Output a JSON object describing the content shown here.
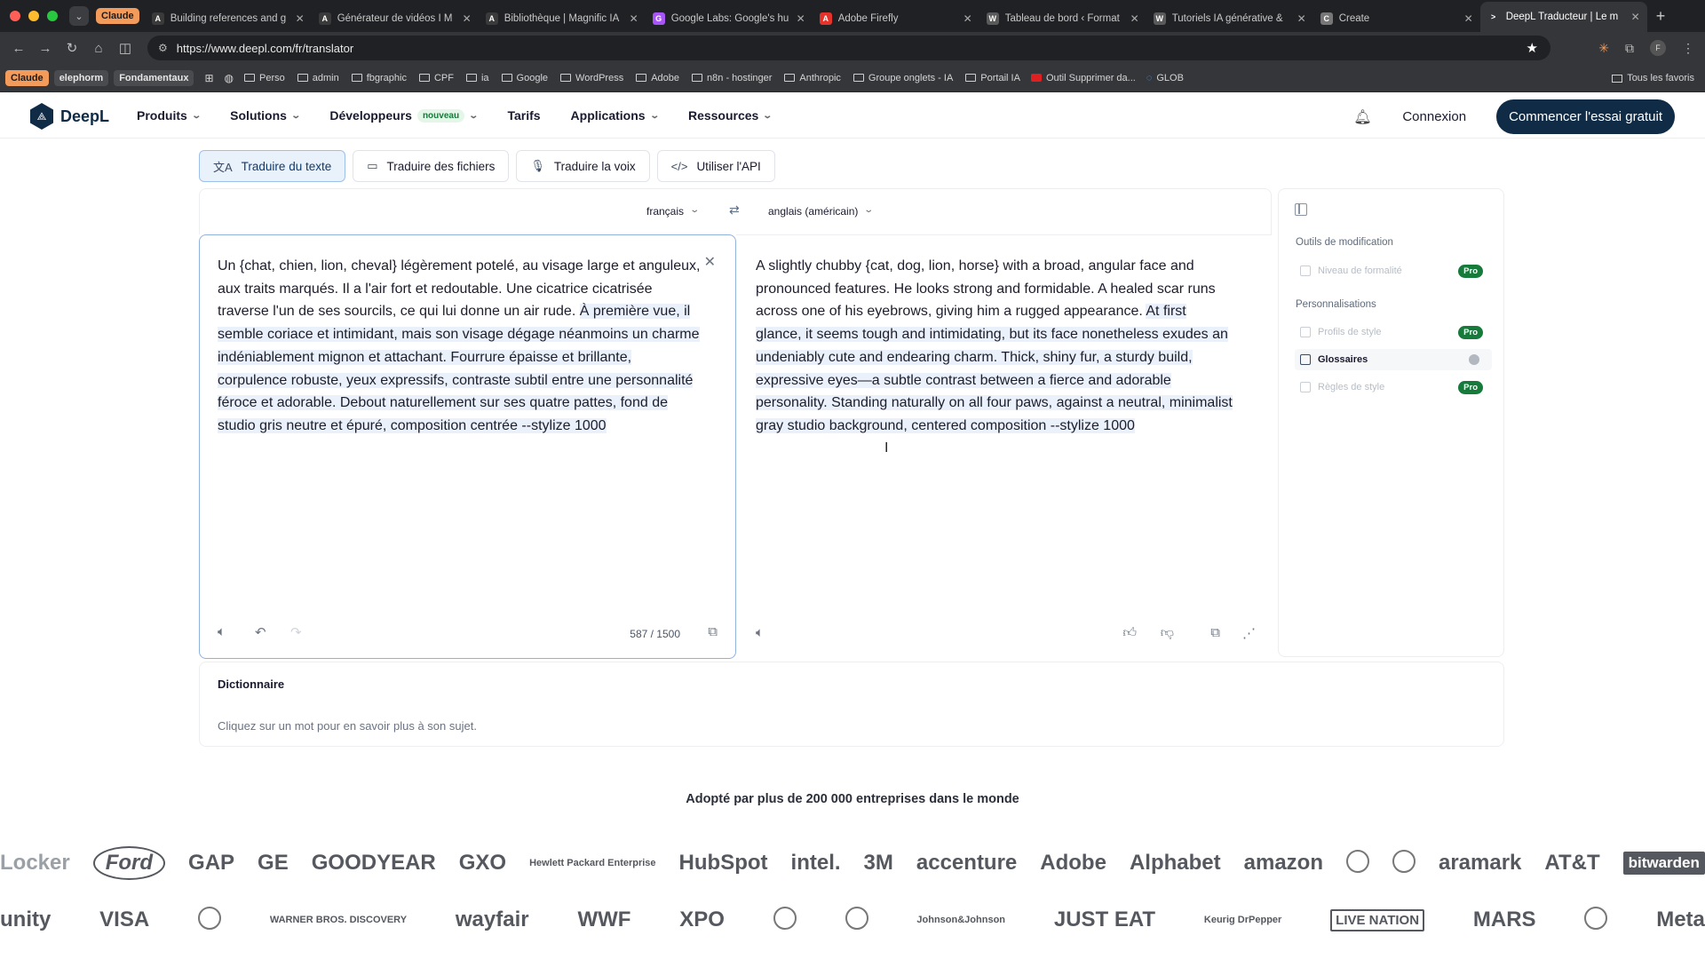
{
  "browser": {
    "tab_group_label": "Claude",
    "tabs": [
      {
        "title": "Building references and g",
        "fav": "A",
        "color": "#3a3a3a"
      },
      {
        "title": "Générateur de vidéos I M",
        "fav": "A",
        "color": "#3a3a3a"
      },
      {
        "title": "Bibliothèque | Magnific IA",
        "fav": "A",
        "color": "#3a3a3a"
      },
      {
        "title": "Google Labs: Google's hu",
        "fav": "G",
        "color": "#a855f7"
      },
      {
        "title": "Adobe Firefly",
        "fav": "A",
        "color": "#e5322b"
      },
      {
        "title": "Tableau de bord ‹ Format",
        "fav": "W",
        "color": "#5a5a5a"
      },
      {
        "title": "Tutoriels IA générative &",
        "fav": "W",
        "color": "#5a5a5a"
      },
      {
        "title": "Create",
        "fav": "C",
        "color": "#777777"
      },
      {
        "title": "DeepL Traducteur | Le m",
        "fav": ">",
        "color": "#35363a"
      }
    ],
    "url": "https://www.deepl.com/fr/translator",
    "profile_initial": "F",
    "bookmarks": {
      "chips": [
        {
          "label": "Claude",
          "bg": "#f29b5b",
          "fg": "#1b1b1b"
        },
        {
          "label": "elephorm",
          "bg": "#4a4b4f",
          "fg": "#e6e6e6"
        },
        {
          "label": "Fondamentaux",
          "bg": "#4a4b4f",
          "fg": "#e6e6e6"
        }
      ],
      "folders": [
        "Perso",
        "admin",
        "fbgraphic",
        "CPF",
        "ia",
        "Google",
        "WordPress",
        "Adobe",
        "n8n - hostinger",
        "Anthropic",
        "Groupe onglets - IA",
        "Portail IA"
      ],
      "extra": [
        "Outil Supprimer da...",
        "GLOB"
      ],
      "all": "Tous les favoris"
    }
  },
  "header": {
    "brand": "DeepL",
    "nav": [
      {
        "label": "Produits",
        "dropdown": true
      },
      {
        "label": "Solutions",
        "dropdown": true
      },
      {
        "label": "Développeurs",
        "dropdown": true,
        "badge": "nouveau"
      },
      {
        "label": "Tarifs",
        "dropdown": false
      },
      {
        "label": "Applications",
        "dropdown": true
      },
      {
        "label": "Ressources",
        "dropdown": true
      }
    ],
    "login": "Connexion",
    "cta": "Commencer l'essai gratuit"
  },
  "modes": [
    {
      "label": "Traduire du texte",
      "icon": "translate-icon",
      "glyph": "文A",
      "active": true
    },
    {
      "label": "Traduire des fichiers",
      "icon": "file-icon",
      "glyph": "▭",
      "active": false
    },
    {
      "label": "Traduire la voix",
      "icon": "microphone-icon",
      "glyph": "🎙",
      "active": false
    },
    {
      "label": "Utiliser l'API",
      "icon": "code-icon",
      "glyph": "</>",
      "active": false
    }
  ],
  "translator": {
    "source_lang": "français",
    "target_lang": "anglais (américain)",
    "source_text_plain": "Un {chat, chien, lion, cheval} légèrement potelé, au visage large et anguleux, aux traits marqués. Il a l'air fort et redoutable. Une cicatrice cicatrisée traverse l'un de ses sourcils, ce qui lui donne un air rude. ",
    "source_text_selected": "À première vue, il semble coriace et intimidant, mais son visage dégage néanmoins un charme indéniablement mignon et attachant. Fourrure épaisse et brillante, corpulence robuste, yeux expressifs, contraste subtil entre une personnalité féroce et adorable. Debout naturellement sur ses quatre pattes, fond de studio gris neutre et épuré, composition centrée --stylize 1000",
    "target_text_plain": "A slightly chubby {cat, dog, lion, horse} with a broad, angular face and pronounced features. He looks strong and formidable. A healed scar runs across one of his eyebrows, giving him a rugged appearance. ",
    "target_text_selected": "At first glance, it seems tough and intimidating, but its face nonetheless exudes an undeniably cute and endearing charm. Thick, shiny fur, a sturdy build, expressive eyes—a subtle contrast between a fierce and adorable personality. Standing naturally on all four paws, against a neutral, minimalist gray studio background, centered composition --stylize 1000",
    "char_count": "587 / 1500"
  },
  "sidebar": {
    "section_edit": "Outils de modification",
    "formality": "Niveau de formalité",
    "section_custom": "Personnalisations",
    "style_profiles": "Profils de style",
    "glossaries": "Glossaires",
    "style_rules": "Règles de style",
    "pro_label": "Pro"
  },
  "dictionary": {
    "title": "Dictionnaire",
    "hint": "Cliquez sur un mot pour en savoir plus à son sujet."
  },
  "adoption": {
    "text": "Adopté par plus de 200 000 entreprises dans le monde",
    "logos_row1": [
      "Locker",
      "Ford",
      "GAP",
      "GE",
      "GOODYEAR",
      "GXO",
      "Hewlett Packard Enterprise",
      "HubSpot",
      "intel.",
      "3M",
      "accenture",
      "Adobe",
      "Alphabet",
      "amazon",
      "",
      "",
      "aramark",
      "AT&T",
      "bitwarden"
    ],
    "logos_row2": [
      "unity",
      "VISA",
      "",
      "WARNER BROS. DISCOVERY",
      "wayfair",
      "WWF",
      "XPO",
      "",
      "",
      "Johnson&Johnson",
      "JUST EAT",
      "Keurig DrPepper",
      "LIVE NATION",
      "MARS",
      "",
      "Meta"
    ]
  },
  "colors": {
    "brand_navy": "#0f2b46",
    "pro_green": "#157a3a",
    "selection": "#eaf1fa",
    "active_border": "#8fb2de"
  }
}
